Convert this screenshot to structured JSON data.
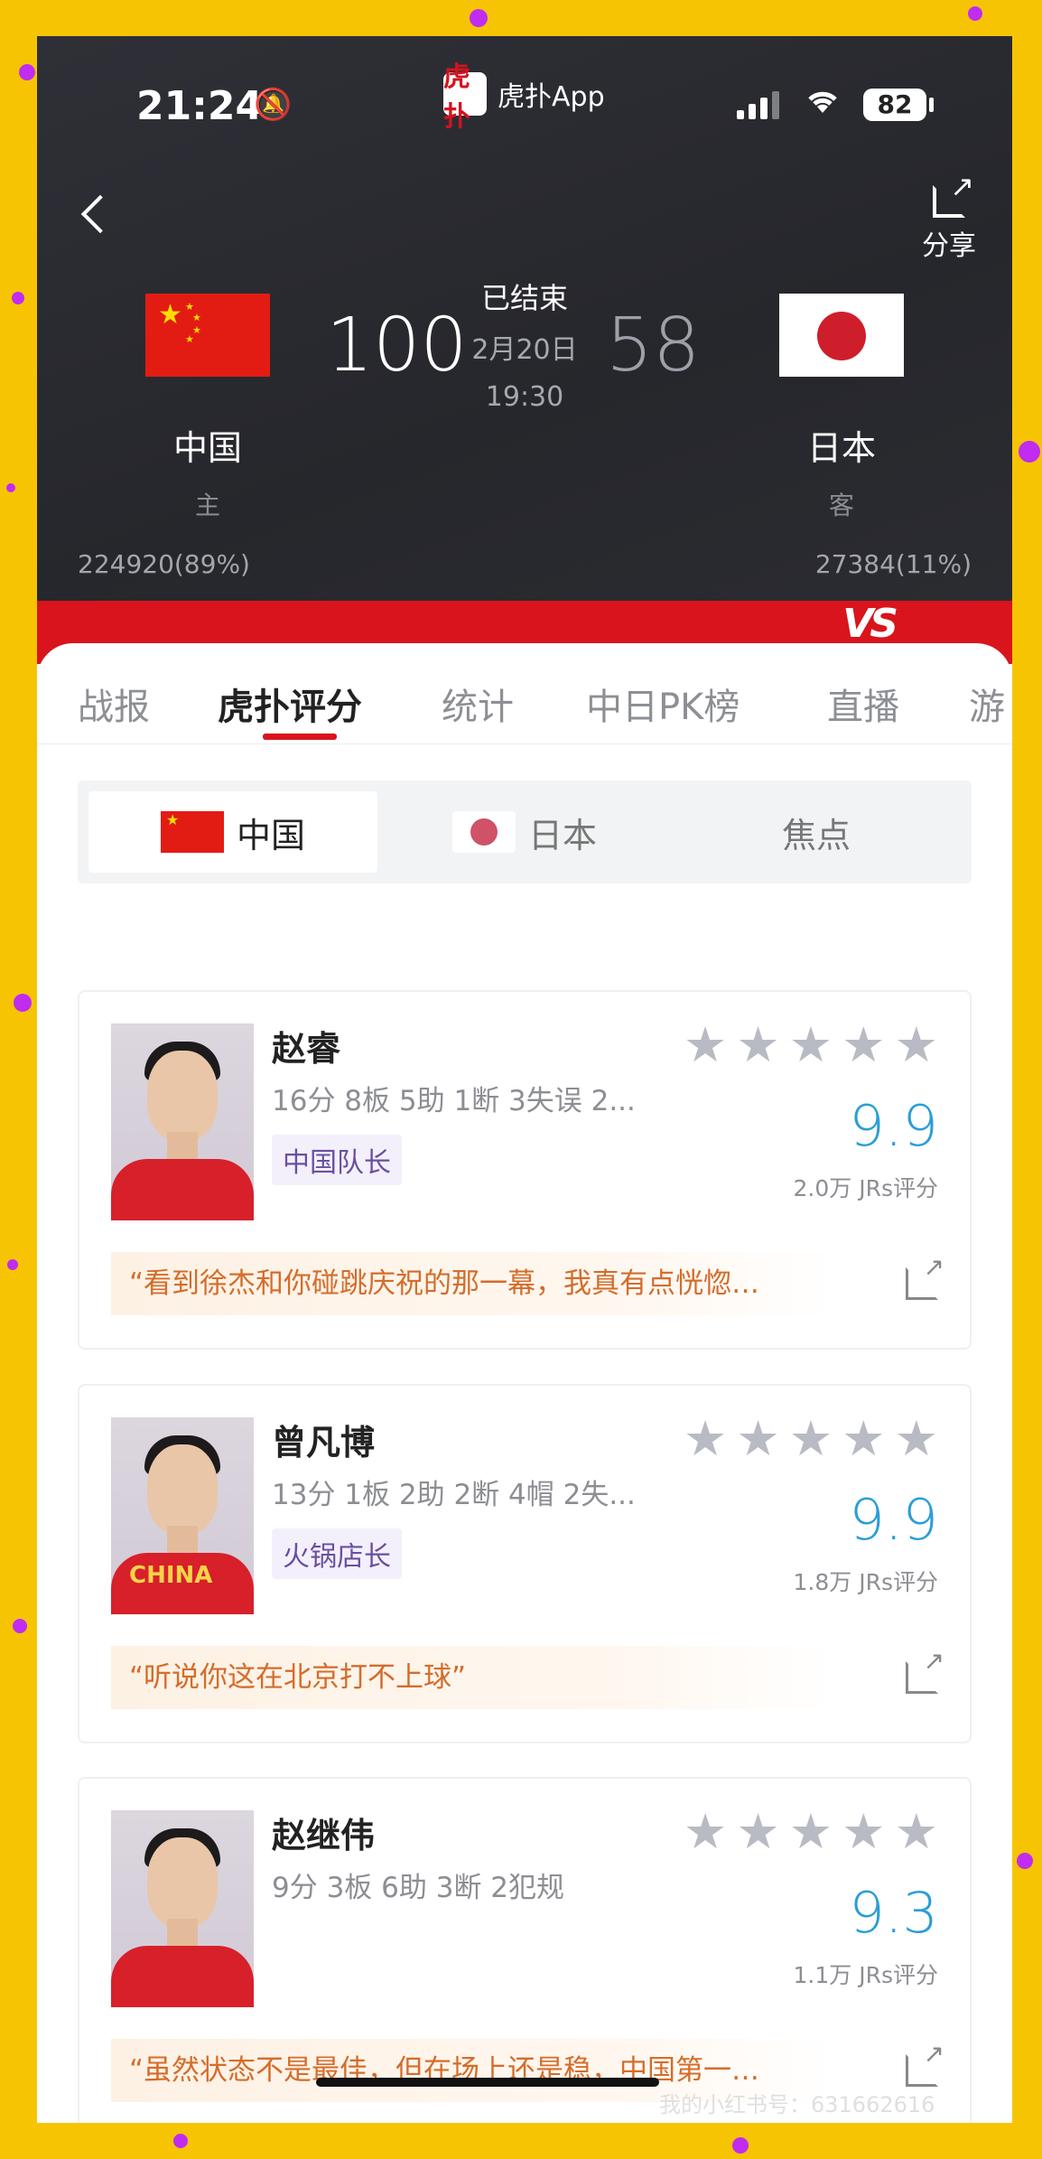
{
  "status_bar": {
    "time": "21:24",
    "battery": "82",
    "app_name": "虎扑App",
    "app_logo_text": "虎扑"
  },
  "header": {
    "share_label": "分享"
  },
  "match": {
    "status": "已结束",
    "date": "2月20日",
    "time": "19:30",
    "home": {
      "name": "中国",
      "role": "主",
      "score": "100",
      "support": "224920(89%)"
    },
    "away": {
      "name": "日本",
      "role": "客",
      "score": "58",
      "support": "27384(11%)"
    },
    "vs_label": "VS"
  },
  "tabs": [
    "战报",
    "虎扑评分",
    "统计",
    "中日PK榜",
    "直播",
    "游"
  ],
  "active_tab": 1,
  "segments": {
    "home": "中国",
    "away": "日本",
    "focus": "焦点"
  },
  "players": [
    {
      "name": "赵睿",
      "stats": "16分 8板 5助 1断 3失误 2...",
      "tag": "中国队长",
      "rating": "9.9",
      "rating_count": "2.0万 JRs评分",
      "quote": "“看到徐杰和你碰跳庆祝的那一幕，我真有点恍惚…",
      "jersey_text": ""
    },
    {
      "name": "曾凡博",
      "stats": "13分 1板 2助 2断 4帽 2失...",
      "tag": "火锅店长",
      "rating": "9.9",
      "rating_count": "1.8万 JRs评分",
      "quote": "“听说你这在北京打不上球”",
      "jersey_text": "CHINA"
    },
    {
      "name": "赵继伟",
      "stats": "9分 3板 6助 3断 2犯规",
      "tag": "",
      "rating": "9.3",
      "rating_count": "1.1万 JRs评分",
      "quote": "“虽然状态不是最佳，但在场上还是稳，中国第一…",
      "jersey_text": ""
    }
  ],
  "watermark": "我的小红书号：631662616",
  "colors": {
    "accent_red": "#d9141c",
    "rating_blue": "#2a9ed8",
    "quote_orange": "#d46d2b",
    "background_yellow": "#f7c404"
  }
}
